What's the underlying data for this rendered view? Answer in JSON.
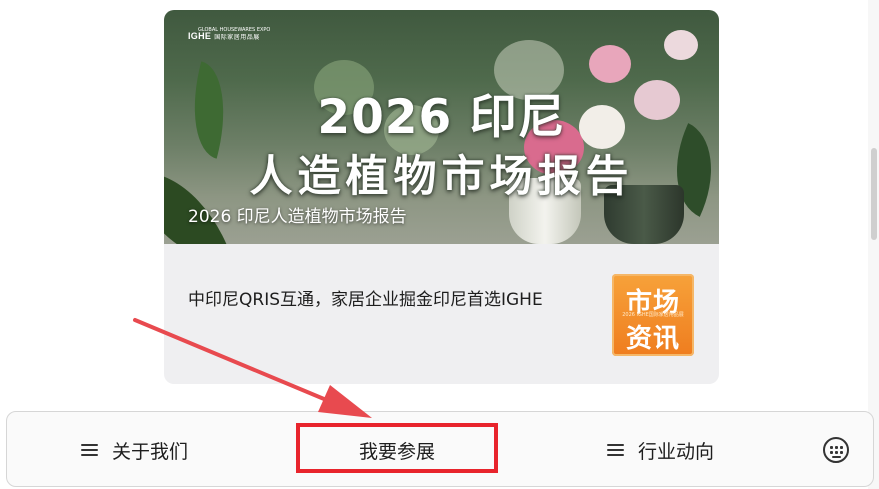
{
  "banner": {
    "logo_small": "GLOBAL HOUSEWARES EXPO",
    "logo_brand": "IGHE",
    "logo_cn": "国际家居用品展",
    "title_year": "2026 印尼",
    "title_main": "人造植物市场报告",
    "caption": "2026 印尼人造植物市场报告"
  },
  "news": {
    "text": "中印尼QRIS互通，家居企业掘金印尼首选IGHE",
    "thumb_line1": "市场",
    "thumb_line2": "资讯",
    "thumb_small": "2026 IGHE国际家居用品展"
  },
  "bottom_nav": {
    "items": [
      {
        "label": "关于我们",
        "icon": "menu-icon"
      },
      {
        "label": "我要参展",
        "icon": ""
      },
      {
        "label": "行业动向",
        "icon": "menu-icon"
      }
    ],
    "keyboard_icon": "keyboard-icon"
  },
  "colors": {
    "highlight": "#e8242c",
    "arrow": "#e84a4f",
    "thumb": "#f08a26"
  }
}
